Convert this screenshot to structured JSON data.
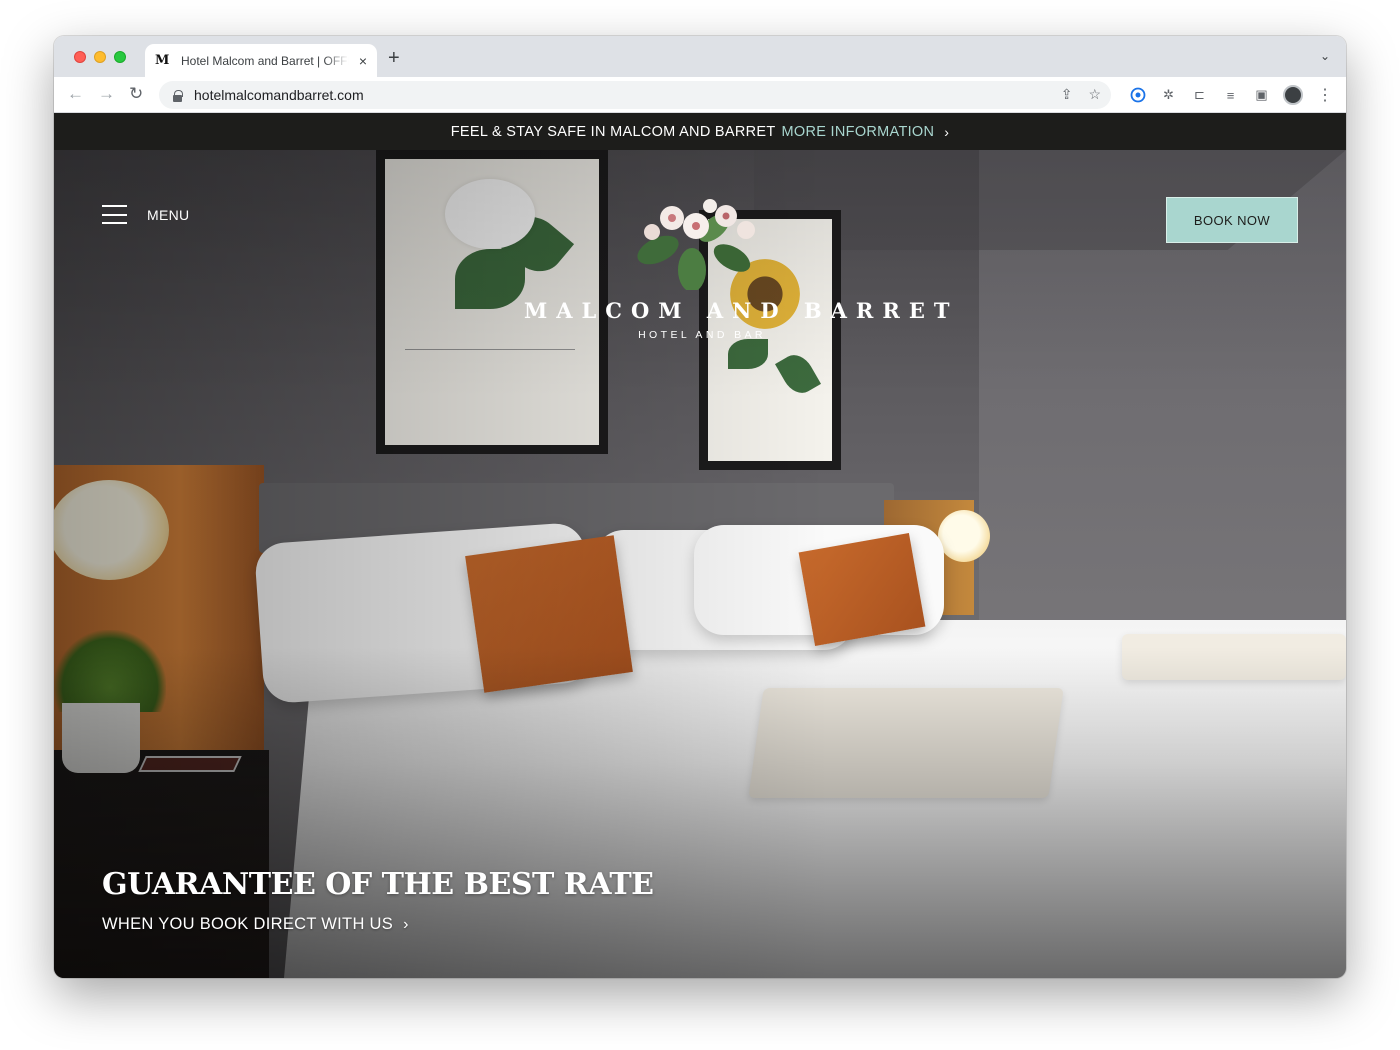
{
  "browser": {
    "tab": {
      "favicon": "M",
      "title": "Hotel Malcom and Barret | OFFICIAL",
      "close_icon": "×"
    },
    "new_tab_icon": "+",
    "tabstrip_menu_icon": "⌄",
    "url": "hotelmalcomandbarret.com",
    "icons": {
      "back": "←",
      "forward": "→",
      "reload": "↻",
      "share": "⇪",
      "bookmark": "☆",
      "extension": "✲",
      "cast": "⊏",
      "media": "≡",
      "sidepanel": "▣",
      "menu": "⋮"
    }
  },
  "banner": {
    "text": "FEEL & STAY SAFE IN MALCOM AND BARRET",
    "link": "MORE INFORMATION",
    "chevron": "›"
  },
  "header": {
    "menu_label": "MENU",
    "book_label": "BOOK NOW",
    "book_color": "#a9d6cf"
  },
  "logo": {
    "title": "MALCOM AND BARRET",
    "subtitle": "HOTEL AND BAR"
  },
  "hero": {
    "headline": "GUARANTEE OF THE BEST RATE",
    "subline": "WHEN YOU BOOK DIRECT WITH US",
    "chevron": "›"
  },
  "colors": {
    "banner_bg": "#1d1d1b",
    "accent": "#a9d6cf",
    "cushion": "#c76a2c"
  }
}
